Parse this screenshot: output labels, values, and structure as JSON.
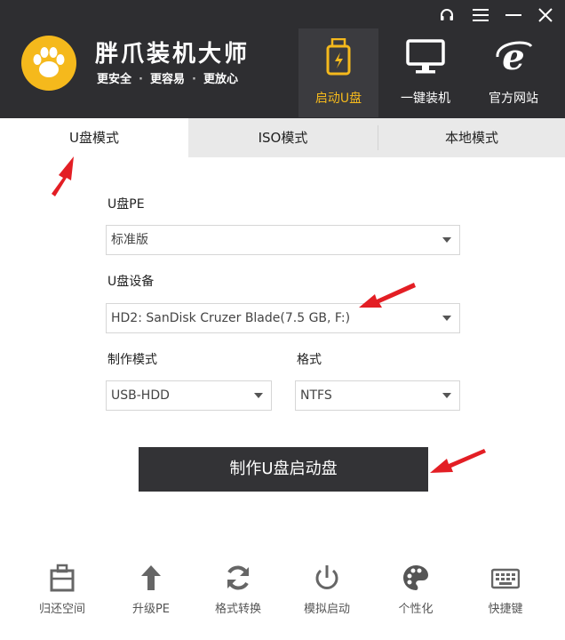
{
  "app": {
    "title": "胖爪装机大师",
    "slogan_items": [
      "更安全",
      "更容易",
      "更放心"
    ],
    "accent_color": "#f5b91c",
    "header_bg": "#2e2e31"
  },
  "window_controls": [
    {
      "name": "support",
      "icon": "headset-icon"
    },
    {
      "name": "menu",
      "icon": "menu-icon"
    },
    {
      "name": "minimize",
      "icon": "minimize-icon"
    },
    {
      "name": "close",
      "icon": "close-icon"
    }
  ],
  "nav": [
    {
      "label": "启动U盘",
      "icon": "usb-drive-icon",
      "active": true
    },
    {
      "label": "一键装机",
      "icon": "monitor-icon",
      "active": false
    },
    {
      "label": "官方网站",
      "icon": "internet-explorer-icon",
      "active": false
    }
  ],
  "tabs": [
    {
      "label": "U盘模式",
      "active": true
    },
    {
      "label": "ISO模式",
      "active": false
    },
    {
      "label": "本地模式",
      "active": false
    }
  ],
  "form": {
    "pe_label": "U盘PE",
    "pe_value": "标准版",
    "device_label": "U盘设备",
    "device_value": "HD2: SanDisk Cruzer Blade(7.5 GB, F:)",
    "mode_label": "制作模式",
    "mode_value": "USB-HDD",
    "format_label": "格式",
    "format_value": "NTFS"
  },
  "make_button": "制作U盘启动盘",
  "tools": [
    {
      "label": "归还空间",
      "icon": "restore-space-icon"
    },
    {
      "label": "升级PE",
      "icon": "upgrade-arrow-icon"
    },
    {
      "label": "格式转换",
      "icon": "convert-arrows-icon"
    },
    {
      "label": "模拟启动",
      "icon": "power-icon"
    },
    {
      "label": "个性化",
      "icon": "palette-icon"
    },
    {
      "label": "快捷键",
      "icon": "keyboard-icon"
    }
  ],
  "annotation_color": "#e31e24"
}
